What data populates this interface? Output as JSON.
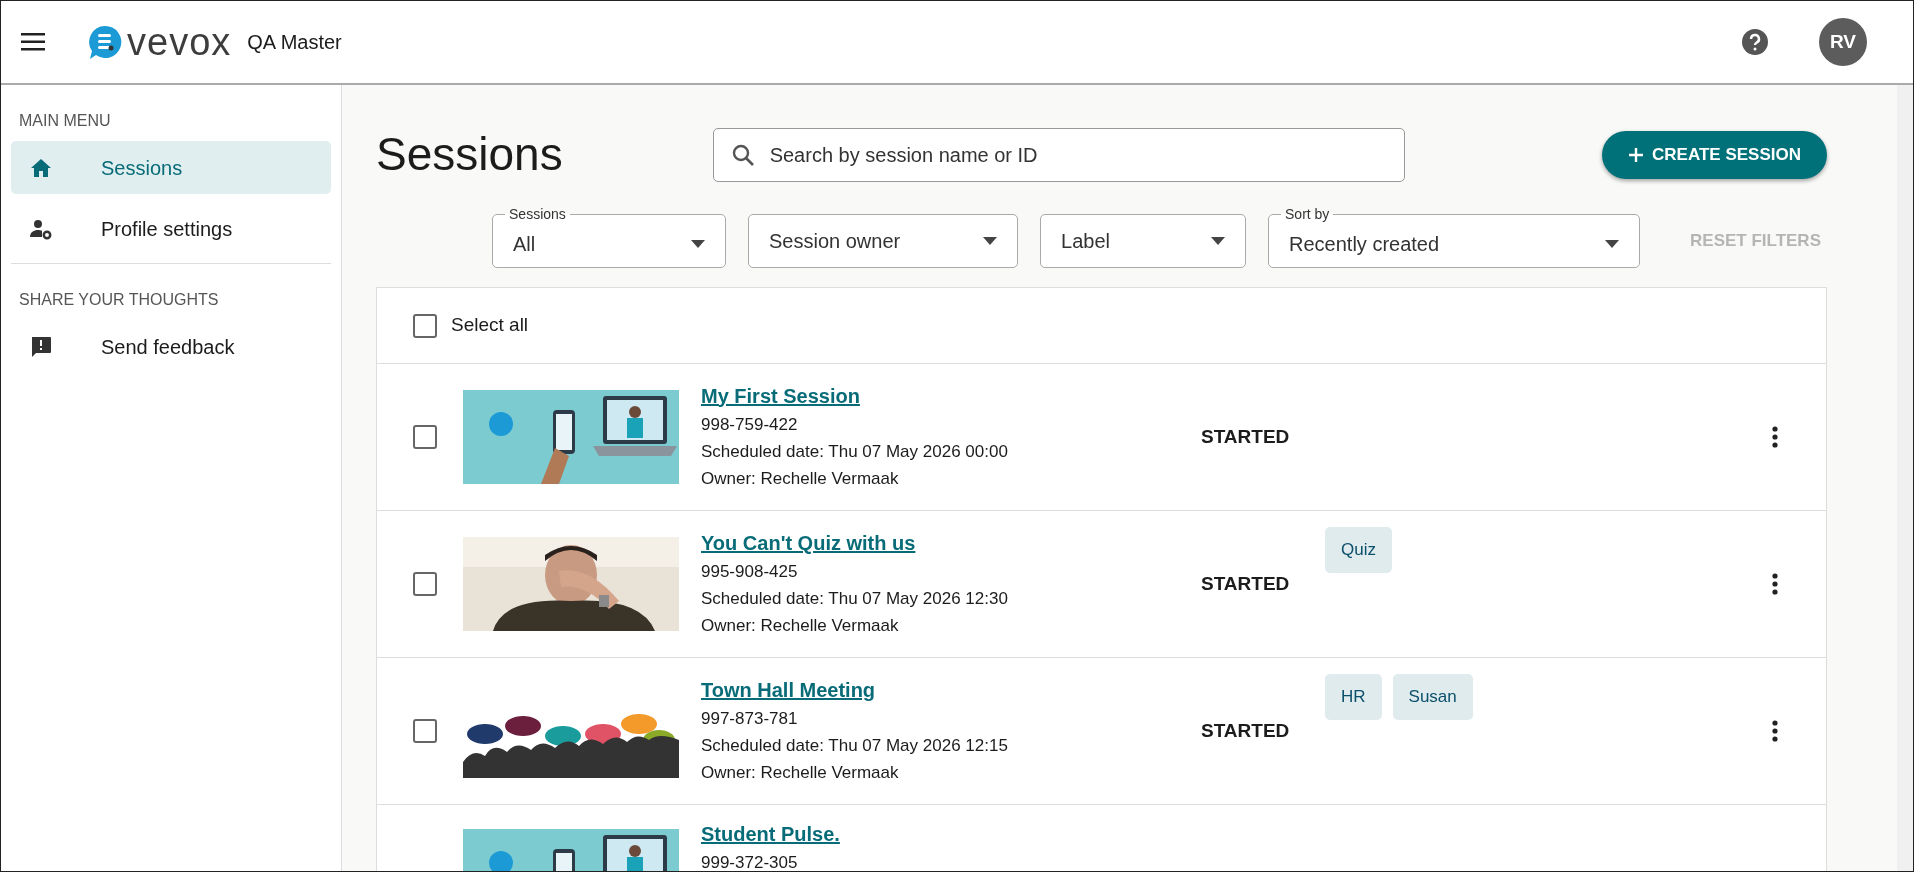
{
  "header": {
    "logo_text": "vevox",
    "org": "QA Master",
    "avatar": "RV"
  },
  "sidebar": [
    {
      "heading": "MAIN MENU",
      "items": [
        {
          "label": "Sessions",
          "kind": "home",
          "selected": true
        },
        {
          "label": "Profile settings",
          "kind": "profile",
          "selected": false
        }
      ]
    },
    {
      "heading": "SHARE YOUR THOUGHTS",
      "items": [
        {
          "label": "Send feedback",
          "kind": "feedback",
          "selected": false
        }
      ]
    }
  ],
  "page": {
    "title": "Sessions",
    "search": {
      "placeholder": "Search by session name or ID"
    },
    "create_button": "CREATE SESSION",
    "filters": [
      {
        "label": "Sessions",
        "value": "All"
      },
      {
        "placeholder": "Session owner"
      },
      {
        "placeholder": "Label"
      },
      {
        "label": "Sort by",
        "value": "Recently created"
      }
    ],
    "reset_filters": {
      "label": "RESET FILTERS",
      "disabled": true
    },
    "select_all": {
      "label": "Select all",
      "checked": false
    },
    "sessions": [
      {
        "title": "My First Session",
        "id": "998-759-422",
        "scheduled": "Scheduled date: Thu 07 May 2026 00:00",
        "owner": "Owner: Rechelle Vermaak",
        "status": "STARTED",
        "checked": false
      },
      {
        "title": "You Can't Quiz with us",
        "id": "995-908-425",
        "scheduled": "Scheduled date: Thu 07 May 2026 12:30",
        "owner": "Owner: Rechelle Vermaak",
        "status": "STARTED",
        "tags": [
          "Quiz"
        ],
        "checked": false
      },
      {
        "title": "Town Hall Meeting",
        "id": "997-873-781",
        "scheduled": "Scheduled date: Thu 07 May 2026 12:15",
        "owner": "Owner: Rechelle Vermaak",
        "status": "STARTED",
        "tags": [
          "HR",
          "Susan"
        ],
        "checked": false
      },
      {
        "title": "Student Pulse.",
        "id": "999-372-305"
      }
    ]
  }
}
